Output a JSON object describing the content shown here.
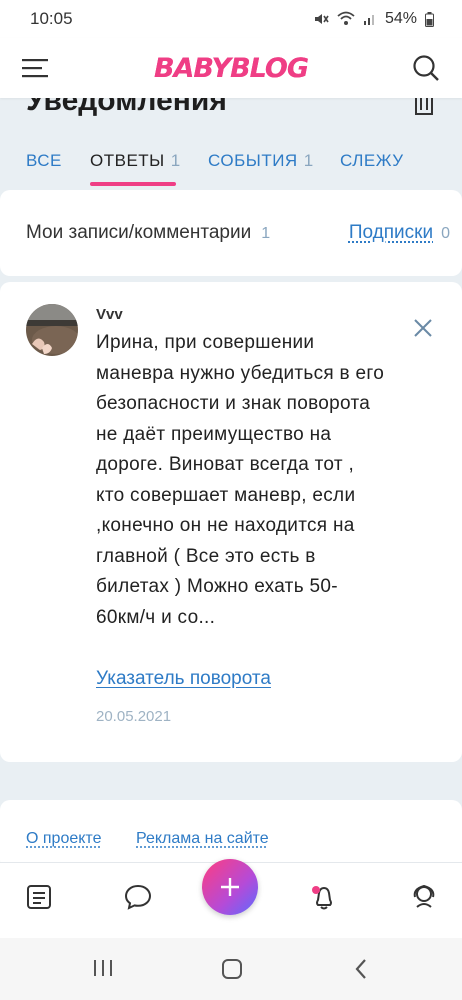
{
  "status_bar": {
    "time": "10:05",
    "battery": "54%",
    "icons": [
      "mute-icon",
      "wifi-icon",
      "signal-icon",
      "battery-icon"
    ]
  },
  "header": {
    "logo": "BABYBLOG",
    "menu_icon": "hamburger-icon",
    "search_icon": "search-icon",
    "brand_color": "#ef3e85"
  },
  "page": {
    "title": "Уведомления",
    "trash_icon": "trash-icon"
  },
  "tabs": [
    {
      "label": "ВСЕ",
      "count": ""
    },
    {
      "label": "ОТВЕТЫ",
      "count": "1",
      "active": true
    },
    {
      "label": "СОБЫТИЯ",
      "count": "1"
    },
    {
      "label": "СЛЕЖУ",
      "count": ""
    }
  ],
  "filter": {
    "left_label": "Мои записи/комментарии",
    "left_count": "1",
    "right_label": "Подписки",
    "right_count": "0"
  },
  "notification": {
    "author": "Vvv",
    "text": "Ирина, при совершении маневра нужно убедиться в его безопасности и знак поворота не даёт преимущество на дороге. Виноват всегда тот , кто совершает маневр, если ,конечно он не находится на главной ( Все это есть в билетах ) Можно ехать 50-60км/ч и со...",
    "link": "Указатель поворота",
    "date": "20.05.2021"
  },
  "footer": {
    "links": [
      "О проекте",
      "Реклама на сайте"
    ]
  },
  "bottom_nav": {
    "items": [
      "feed-icon",
      "chat-icon",
      "add-icon",
      "notifications-icon",
      "profile-icon"
    ],
    "fab_symbol": "+"
  },
  "system_nav": [
    "recents-icon",
    "home-icon",
    "back-icon"
  ],
  "colors": {
    "accent": "#2e7bc6",
    "muted": "#8aa6bf",
    "background": "#e9eff3"
  }
}
